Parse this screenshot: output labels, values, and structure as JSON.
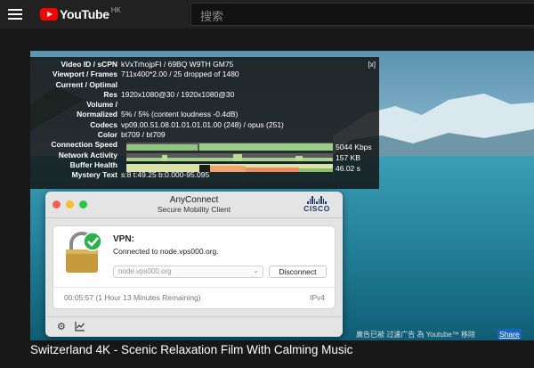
{
  "header": {
    "logo_text": "YouTube",
    "region": "HK",
    "search_placeholder": "搜索"
  },
  "stats": {
    "close": "[x]",
    "rows": [
      {
        "key": "Video ID / sCPN",
        "value": "kVxTrhojpFI / 69BQ W9TH GM75"
      },
      {
        "key": "Viewport / Frames",
        "value": "711x400*2.00 / 25 dropped of 1480"
      },
      {
        "key": "Current / Optimal",
        "value": ""
      },
      {
        "key": "Res",
        "value": "1920x1080@30 / 1920x1080@30"
      },
      {
        "key": "Volume /",
        "value": ""
      },
      {
        "key": "Normalized",
        "value": "5% / 5% (content loudness -0.4dB)"
      },
      {
        "key": "Codecs",
        "value": "vp09.00.51.08.01.01.01.01.00 (248) / opus (251)"
      },
      {
        "key": "Color",
        "value": "bt709 / bt709"
      },
      {
        "key": "Connection Speed",
        "value": "5044 Kbps"
      },
      {
        "key": "Network Activity",
        "value": "157 KB"
      },
      {
        "key": "Buffer Health",
        "value": "46.02 s"
      },
      {
        "key": "Mystery Text",
        "value": "s:8 t:49.25 b:0.000-95.095"
      }
    ]
  },
  "anyconnect": {
    "title": "AnyConnect",
    "subtitle": "Secure Mobility Client",
    "brand": "CISCO",
    "vpn_label": "VPN:",
    "status": "Connected to node.vps000.org.",
    "server_value": "node.vps000.org",
    "disconnect": "Disconnect",
    "timer": "00:05:57 (1 Hour 13 Minutes Remaining)",
    "protocol": "IPv4"
  },
  "video": {
    "ad_note": "廣告已被 过濾广告 為 Youtube™ 移除",
    "share": "Share",
    "title": "Switzerland 4K - Scenic Relaxation Film With Calming Music"
  },
  "colors": {
    "youtube_red": "#ff0000",
    "cisco_blue": "#1f3a66",
    "connected_green": "#2bb24c"
  }
}
